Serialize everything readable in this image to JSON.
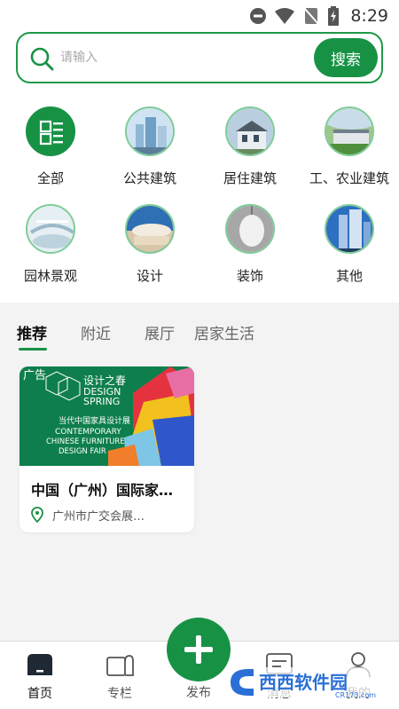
{
  "status_bar": {
    "time": "8:29"
  },
  "search": {
    "placeholder": "请输入",
    "button_label": "搜索"
  },
  "categories": [
    {
      "label": "全部"
    },
    {
      "label": "公共建筑"
    },
    {
      "label": "居住建筑"
    },
    {
      "label": "工、农业建筑"
    },
    {
      "label": "园林景观"
    },
    {
      "label": "设计"
    },
    {
      "label": "装饰"
    },
    {
      "label": "其他"
    }
  ],
  "tabs": [
    {
      "label": "推荐"
    },
    {
      "label": "附近"
    },
    {
      "label": "展厅"
    },
    {
      "label": "居家生活"
    }
  ],
  "card": {
    "title": "中国（广州）国际家…",
    "location": "广州市广交会展…",
    "poster": {
      "line1": "设计之春",
      "line2": "DESIGN",
      "line3": "SPRING",
      "line4": "当代中国家具设计展",
      "line5": "CONTEMPORARY",
      "line6": "CHINESE FURNITURE",
      "line7": "DESIGN FAIR"
    }
  },
  "bottom_nav": [
    {
      "label": "首页"
    },
    {
      "label": "专栏"
    },
    {
      "label": "发布"
    },
    {
      "label": "消息"
    },
    {
      "label": "我的"
    }
  ],
  "watermark": {
    "text": "西西软件园",
    "sub": "CR173.com"
  },
  "colors": {
    "accent": "#179245",
    "accent_light": "#7ecb98"
  }
}
